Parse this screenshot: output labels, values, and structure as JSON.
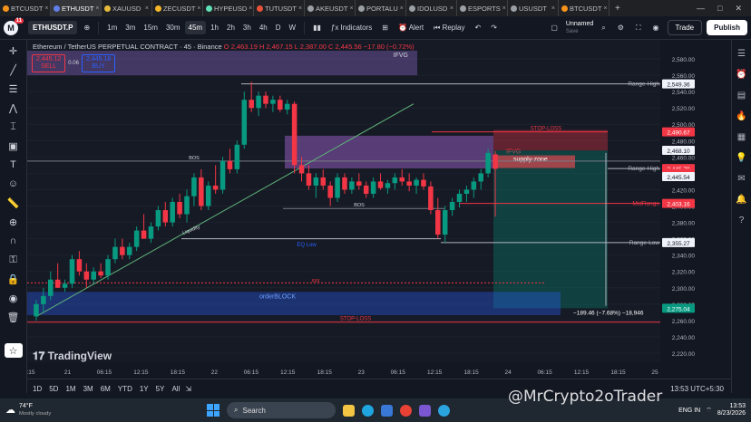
{
  "browser": {
    "tabs": [
      {
        "label": "BTCUSDT",
        "color": "#f7931a",
        "active": false
      },
      {
        "label": "ETHUSDT",
        "color": "#627eea",
        "active": true
      },
      {
        "label": "XAUUSD",
        "color": "#e5b93c",
        "active": false
      },
      {
        "label": "ZECUSDT",
        "color": "#f4b728",
        "active": false
      },
      {
        "label": "HYPEUSD",
        "color": "#5fe0b5",
        "active": false
      },
      {
        "label": "TUTUSDT",
        "color": "#e8533a",
        "active": false
      },
      {
        "label": "AKEUSDT",
        "color": "#9aa0a6",
        "active": false
      },
      {
        "label": "PORTALU",
        "color": "#9aa0a6",
        "active": false
      },
      {
        "label": "IDOLUSD",
        "color": "#9aa0a6",
        "active": false
      },
      {
        "label": "ESPORTS",
        "color": "#9aa0a6",
        "active": false
      },
      {
        "label": "USUSDT",
        "color": "#9aa0a6",
        "active": false
      },
      {
        "label": "BTCUSDT",
        "color": "#f7931a",
        "active": false
      }
    ],
    "close_label": "×",
    "new_tab": "+",
    "min": "—",
    "max": "□",
    "close": "✕"
  },
  "toolbar": {
    "logo": "M",
    "notif": "11",
    "symbol": "ETHUSDT.P",
    "timeframes": [
      "1m",
      "3m",
      "15m",
      "30m",
      "45m",
      "1h",
      "2h",
      "3h",
      "4h",
      "D",
      "W"
    ],
    "selected_tf": "45m",
    "indicators": "Indicators",
    "alert": "Alert",
    "replay": "Replay",
    "layout_name": "Unnamed",
    "layout_sub": "Save",
    "trade": "Trade",
    "publish": "Publish"
  },
  "legend": {
    "title": "Ethereum / TetherUS PERPETUAL CONTRACT · 45 · Binance",
    "ohlc": "O 2,463.19 H 2,467.15 L 2,387.00 C 2,445.56 −17.80 (−0.72%)",
    "sell_price": "2,445.12",
    "sell": "SELL",
    "spread": "0.06",
    "buy_price": "2,445.18",
    "buy": "BUY"
  },
  "chart_data": {
    "type": "candlestick",
    "symbol": "ETHUSDT.P",
    "timeframe": "45",
    "ylim": [
      2220,
      2590
    ],
    "yticks": [
      2580,
      2560,
      2540,
      2520,
      2500,
      2480,
      2460,
      2440,
      2420,
      2400,
      2380,
      2360,
      2340,
      2320,
      2300,
      2280,
      2260,
      2240,
      2220
    ],
    "xticks": [
      ":15",
      "21",
      "06:15",
      "12:15",
      "18:15",
      "22",
      "06:15",
      "12:15",
      "18:15",
      "23",
      "06:15",
      "12:15",
      "18:15",
      "24",
      "06:15",
      "12:15",
      "18:15",
      "25"
    ],
    "levels": [
      {
        "name": "Range-High",
        "value": 2549.36
      },
      {
        "name": "Range-High",
        "value": 2445.79
      },
      {
        "name": "MidRange",
        "value": 2403.16
      },
      {
        "name": "Range-Low",
        "value": 2355.27
      },
      {
        "name": "STOP-LOSS",
        "value": 2490.67
      },
      {
        "name": "STOP-LOSS",
        "value": 2258
      }
    ],
    "price_labels": [
      {
        "text": "2,549.36",
        "bg": "#f0f3fa",
        "fg": "#131722"
      },
      {
        "text": "2,490.67",
        "bg": "#f23645",
        "fg": "#ffffff"
      },
      {
        "text": "2,468.10",
        "bg": "#f0f3fa",
        "fg": "#131722"
      },
      {
        "text": "2,445.79",
        "bg": "#f23645",
        "fg": "#ffffff"
      },
      {
        "text": "05:57",
        "bg": "#f23645",
        "fg": "#ffffff"
      },
      {
        "text": "2,445.54",
        "bg": "#f0f3fa",
        "fg": "#131722"
      },
      {
        "text": "2,403.16",
        "bg": "#f23645",
        "fg": "#ffffff"
      },
      {
        "text": "2,355.27",
        "bg": "#f0f3fa",
        "fg": "#131722"
      },
      {
        "text": "2,275.04",
        "bg": "#089981",
        "fg": "#ffffff"
      }
    ],
    "annotations": [
      "IFVG",
      "IFVG",
      "supply-zone",
      "BOS",
      "BOS",
      "Liquidity",
      "EQ Low",
      "xxx",
      "orderBLOCK",
      "STOP-LOSS",
      "STOP-LOSS"
    ],
    "measure": "−189.46 (−7.68%) −18,946",
    "candles": [
      [
        2265,
        2285,
        2260,
        2280
      ],
      [
        2280,
        2300,
        2270,
        2290
      ],
      [
        2290,
        2320,
        2285,
        2310
      ],
      [
        2310,
        2330,
        2300,
        2300
      ],
      [
        2300,
        2310,
        2295,
        2305
      ],
      [
        2305,
        2340,
        2300,
        2335
      ],
      [
        2335,
        2345,
        2315,
        2320
      ],
      [
        2320,
        2330,
        2300,
        2310
      ],
      [
        2310,
        2325,
        2305,
        2320
      ],
      [
        2320,
        2330,
        2312,
        2315
      ],
      [
        2315,
        2340,
        2310,
        2335
      ],
      [
        2335,
        2360,
        2330,
        2350
      ],
      [
        2350,
        2360,
        2335,
        2340
      ],
      [
        2340,
        2355,
        2335,
        2350
      ],
      [
        2350,
        2375,
        2345,
        2370
      ],
      [
        2370,
        2390,
        2360,
        2360
      ],
      [
        2360,
        2380,
        2355,
        2375
      ],
      [
        2375,
        2400,
        2370,
        2395
      ],
      [
        2395,
        2405,
        2375,
        2380
      ],
      [
        2380,
        2410,
        2375,
        2405
      ],
      [
        2405,
        2415,
        2385,
        2390
      ],
      [
        2390,
        2420,
        2380,
        2412
      ],
      [
        2412,
        2440,
        2400,
        2435
      ],
      [
        2435,
        2445,
        2395,
        2400
      ],
      [
        2400,
        2430,
        2395,
        2425
      ],
      [
        2425,
        2450,
        2415,
        2420
      ],
      [
        2420,
        2460,
        2415,
        2455
      ],
      [
        2455,
        2470,
        2440,
        2445
      ],
      [
        2445,
        2480,
        2440,
        2475
      ],
      [
        2475,
        2540,
        2470,
        2530
      ],
      [
        2530,
        2552,
        2515,
        2520
      ],
      [
        2520,
        2540,
        2510,
        2535
      ],
      [
        2535,
        2540,
        2520,
        2525
      ],
      [
        2525,
        2535,
        2515,
        2530
      ],
      [
        2530,
        2535,
        2515,
        2518
      ],
      [
        2518,
        2530,
        2512,
        2525
      ],
      [
        2525,
        2528,
        2440,
        2450
      ],
      [
        2450,
        2460,
        2430,
        2440
      ],
      [
        2440,
        2450,
        2420,
        2425
      ],
      [
        2425,
        2440,
        2410,
        2435
      ],
      [
        2435,
        2445,
        2420,
        2425
      ],
      [
        2425,
        2430,
        2400,
        2410
      ],
      [
        2410,
        2440,
        2405,
        2435
      ],
      [
        2435,
        2440,
        2415,
        2420
      ],
      [
        2420,
        2435,
        2415,
        2430
      ],
      [
        2430,
        2440,
        2420,
        2425
      ],
      [
        2425,
        2430,
        2410,
        2415
      ],
      [
        2415,
        2435,
        2410,
        2430
      ],
      [
        2430,
        2440,
        2420,
        2422
      ],
      [
        2422,
        2432,
        2415,
        2428
      ],
      [
        2428,
        2440,
        2420,
        2435
      ],
      [
        2435,
        2445,
        2425,
        2430
      ],
      [
        2430,
        2440,
        2418,
        2425
      ],
      [
        2425,
        2435,
        2415,
        2432
      ],
      [
        2432,
        2440,
        2420,
        2424
      ],
      [
        2424,
        2430,
        2390,
        2395
      ],
      [
        2395,
        2410,
        2360,
        2365
      ],
      [
        2365,
        2400,
        2355,
        2395
      ],
      [
        2395,
        2410,
        2388,
        2405
      ],
      [
        2405,
        2420,
        2398,
        2415
      ],
      [
        2415,
        2425,
        2405,
        2420
      ],
      [
        2420,
        2435,
        2410,
        2430
      ],
      [
        2430,
        2445,
        2420,
        2440
      ],
      [
        2440,
        2470,
        2435,
        2465
      ],
      [
        2463.19,
        2467.15,
        2387,
        2445.56
      ]
    ]
  },
  "bottom": {
    "ranges": [
      "1D",
      "5D",
      "1M",
      "3M",
      "6M",
      "YTD",
      "1Y",
      "5Y",
      "All"
    ],
    "clock": "13:53 UTC+5:30"
  },
  "taskbar": {
    "temp": "74°F",
    "weather": "Mostly cloudy",
    "search": "Search",
    "lang": "ENG IN",
    "time": "13:53",
    "date": "8/23/2026"
  },
  "watermark": "@MrCrypto2oTrader"
}
